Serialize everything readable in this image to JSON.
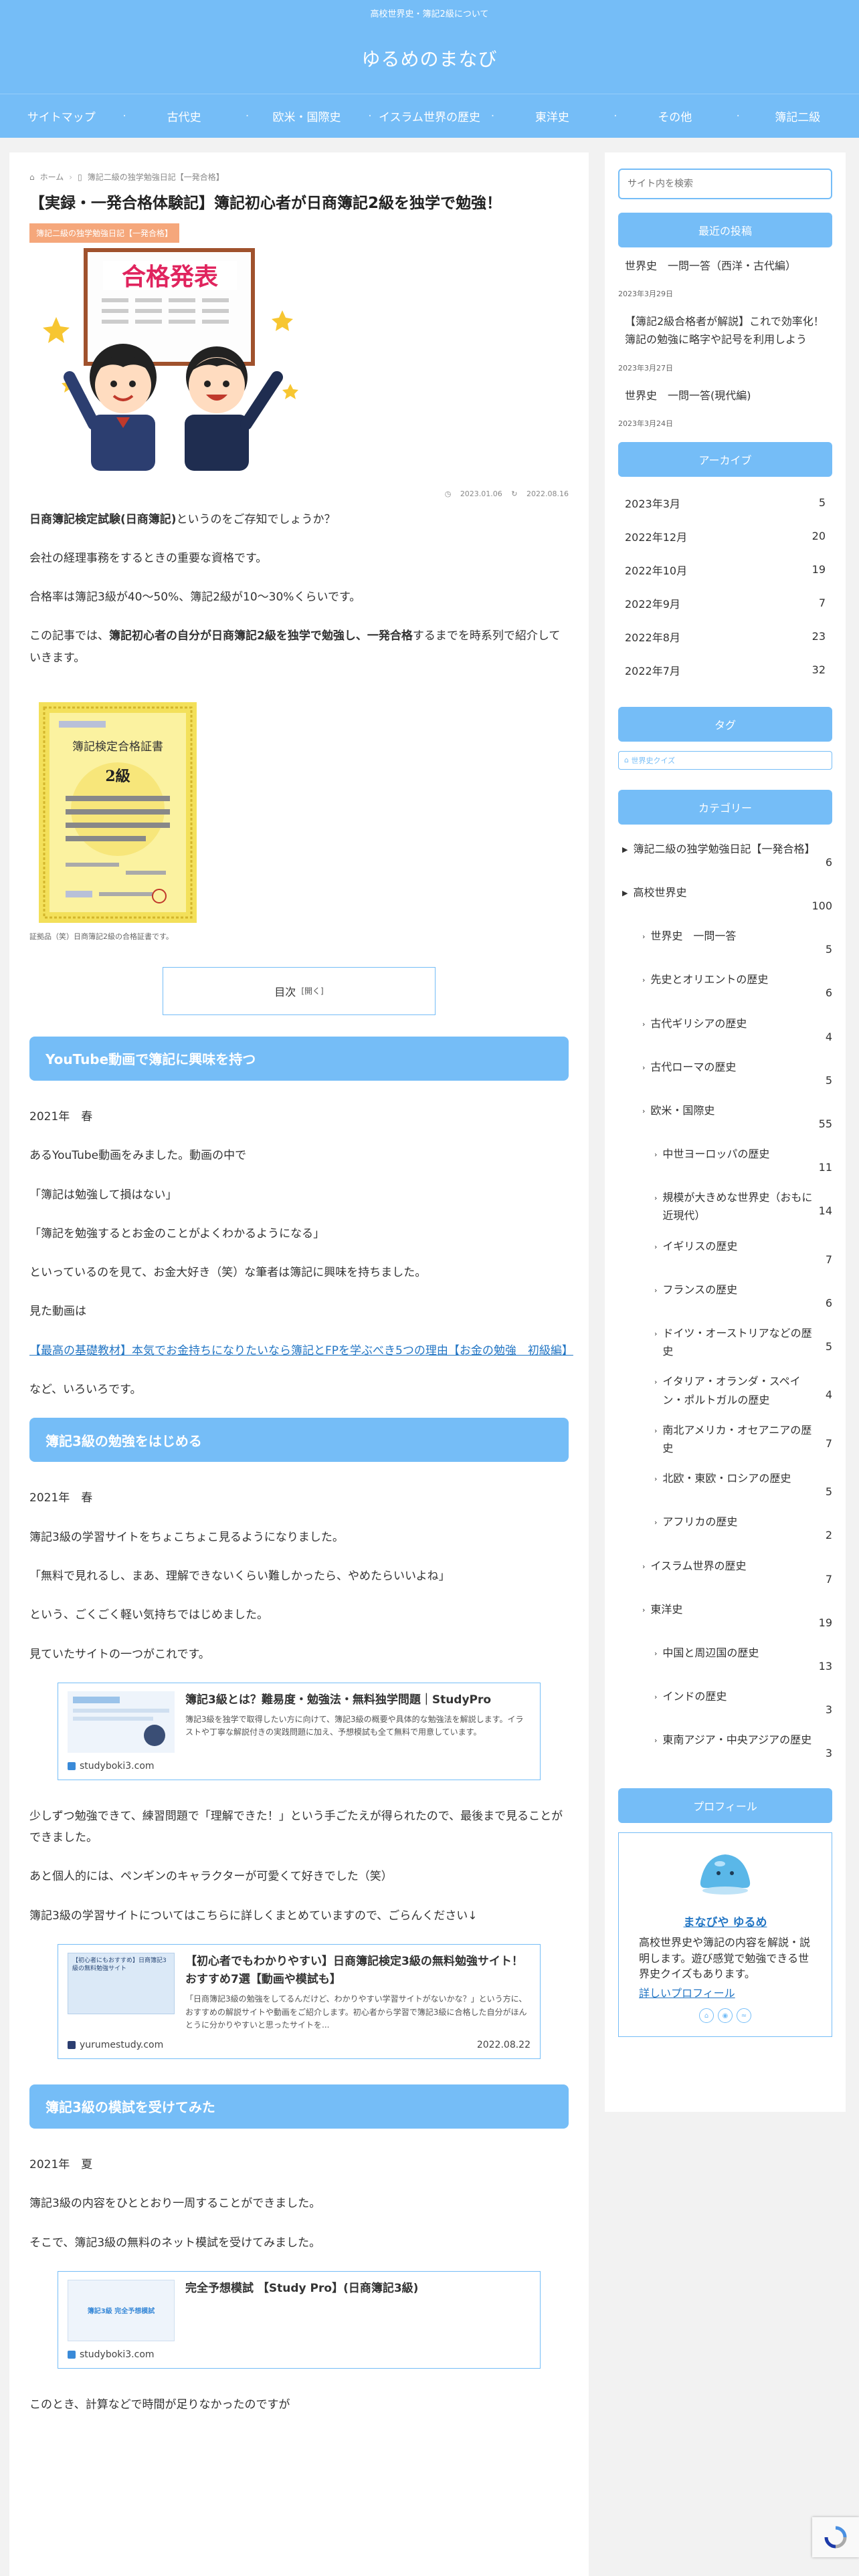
{
  "header": {
    "tagline": "高校世界史・簿記2級について",
    "site_title": "ゆるめのまなび"
  },
  "nav": [
    "サイトマップ",
    "古代史",
    "欧米・国際史",
    "イスラム世界の歴史",
    "東洋史",
    "その他",
    "簿記二級"
  ],
  "breadcrumb": {
    "home": "ホーム",
    "category": "簿記二級の独学勉強日記【一発合格】"
  },
  "article": {
    "title": "【実録・一発合格体験記】簿記初心者が日商簿記2級を独学で勉強！",
    "category_label": "簿記二級の独学勉強日記【一発合格】",
    "eyecatch_sign": "合格発表",
    "published": "2023.01.06",
    "updated": "2022.08.16",
    "intro": {
      "p1_bold": "日商簿記検定試験(日商簿記)",
      "p1_rest": "というのをご存知でしょうか？",
      "p2": "会社の経理事務をするときの重要な資格です。",
      "p3": "合格率は簿記3級が40～50%、簿記2級が10～30%くらいです。",
      "p4_pre": "この記事では、",
      "p4_bold": "簿記初心者の自分が日商簿記2級を独学で勉強し、一発合格",
      "p4_rest": "するまでを時系列で紹介していきます。"
    },
    "certificate": {
      "title": "簿記検定合格証書",
      "grade": "2級",
      "body": "商工会議所2021年度施行検定試験において頭書の級に合格したことを証する",
      "caption": "証拠品（笑）日商簿記2級の合格証書です。"
    },
    "toc": {
      "label": "目次",
      "toggle": "[開く]"
    },
    "sections": [
      {
        "heading": "YouTube動画で簿記に興味を持つ",
        "paras": [
          "2021年　春",
          "あるYouTube動画をみました。動画の中で",
          "「簿記は勉強して損はない」",
          "「簿記を勉強するとお金のことがよくわかるようになる」",
          "といっているのを見て、お金大好き（笑）な筆者は簿記に興味を持ちました。",
          "見た動画は"
        ],
        "link": "【最高の基礎教材】本気でお金持ちになりたいなら簿記とFPを学ぶべき5つの理由【お金の勉強　初級編】",
        "after": "など、いろいろです。"
      },
      {
        "heading": "簿記3級の勉強をはじめる",
        "paras": [
          "2021年　春",
          "簿記3級の学習サイトをちょこちょこ見るようになりました。",
          "「無料で見れるし、まあ、理解できないくらい難しかったら、やめたらいいよね」",
          "という、ごくごく軽い気持ちではじめました。",
          "見ていたサイトの一つがこれです。"
        ],
        "card1": {
          "title": "簿記3級とは？難易度・勉強法・無料独学問題｜StudyPro",
          "desc": "簿記3級を独学で取得したい方に向けて、簿記3級の概要や具体的な勉強法を解説します。イラストや丁寧な解説付きの実践問題に加え、予想模試も全て無料で用意しています。",
          "site": "studyboki3.com"
        },
        "paras2": [
          "少しずつ勉強できて、練習問題で「理解できた！」という手ごたえが得られたので、最後まで見ることができました。",
          "あと個人的には、ペンギンのキャラクターが可愛くて好きでした（笑）",
          "簿記3級の学習サイトについてはこちらに詳しくまとめていますので、ごらんください↓"
        ],
        "card2": {
          "title": "【初心者でもわかりやすい】日商簿記検定3級の無料勉強サイト！おすすめ7選【動画や模試も】",
          "desc": "「日商簿記3級の勉強をしてるんだけど、わかりやすい学習サイトがないかな？」という方に、おすすめの解説サイトや動画をご紹介します。初心者から学習で簿記3級に合格した自分がほんとうに分かりやすいと思ったサイトを...",
          "site": "yurumestudy.com",
          "date": "2022.08.22",
          "thumb_text": "【初心者にもおすすめ】日商簿記3級の無料勉強サイト"
        }
      },
      {
        "heading": "簿記3級の模試を受けてみた",
        "paras": [
          "2021年　夏",
          "簿記3級の内容をひととおり一周することができました。",
          "そこで、簿記3級の無料のネット模試を受けてみました。"
        ],
        "card3": {
          "title": "完全予想模試 【Study Pro】(日商簿記3級)",
          "site": "studyboki3.com",
          "thumb_text": "簿記3級 完全予想模試"
        },
        "after": "このとき、計算などで時間が足りなかったのですが"
      }
    ]
  },
  "sidebar": {
    "search_placeholder": "サイト内を検索",
    "recent_heading": "最近の投稿",
    "recent": [
      {
        "title": "世界史　一問一答（西洋・古代編）",
        "date": "2023年3月29日"
      },
      {
        "title": "【簿記2級合格者が解説】これで効率化！簿記の勉強に略字や記号を利用しよう",
        "date": "2023年3月27日"
      },
      {
        "title": "世界史　一問一答(現代編)",
        "date": "2023年3月24日"
      }
    ],
    "archive_heading": "アーカイブ",
    "archives": [
      {
        "label": "2023年3月",
        "count": "5"
      },
      {
        "label": "2022年12月",
        "count": "20"
      },
      {
        "label": "2022年10月",
        "count": "19"
      },
      {
        "label": "2022年9月",
        "count": "7"
      },
      {
        "label": "2022年8月",
        "count": "23"
      },
      {
        "label": "2022年7月",
        "count": "32"
      }
    ],
    "tag_heading": "タグ",
    "tag_label": "世界史クイズ",
    "category_heading": "カテゴリー",
    "categories": [
      {
        "label": "簿記二級の独学勉強日記【一発合格】",
        "count": "6",
        "level": 0
      },
      {
        "label": "高校世界史",
        "count": "100",
        "level": 0
      },
      {
        "label": "世界史　一問一答",
        "count": "5",
        "level": 1
      },
      {
        "label": "先史とオリエントの歴史",
        "count": "6",
        "level": 1
      },
      {
        "label": "古代ギリシアの歴史",
        "count": "4",
        "level": 1
      },
      {
        "label": "古代ローマの歴史",
        "count": "5",
        "level": 1
      },
      {
        "label": "欧米・国際史",
        "count": "55",
        "level": 1
      },
      {
        "label": "中世ヨーロッパの歴史",
        "count": "11",
        "level": 2
      },
      {
        "label": "規模が大きめな世界史（おもに近現代）",
        "count": "14",
        "level": 2
      },
      {
        "label": "イギリスの歴史",
        "count": "7",
        "level": 2
      },
      {
        "label": "フランスの歴史",
        "count": "6",
        "level": 2
      },
      {
        "label": "ドイツ・オーストリアなどの歴史",
        "count": "5",
        "level": 2
      },
      {
        "label": "イタリア・オランダ・スペイン・ポルトガルの歴史",
        "count": "4",
        "level": 2
      },
      {
        "label": "南北アメリカ・オセアニアの歴史",
        "count": "7",
        "level": 2
      },
      {
        "label": "北欧・東欧・ロシアの歴史",
        "count": "5",
        "level": 2
      },
      {
        "label": "アフリカの歴史",
        "count": "2",
        "level": 2
      },
      {
        "label": "イスラム世界の歴史",
        "count": "7",
        "level": 1
      },
      {
        "label": "東洋史",
        "count": "19",
        "level": 1
      },
      {
        "label": "中国と周辺国の歴史",
        "count": "13",
        "level": 2
      },
      {
        "label": "インドの歴史",
        "count": "3",
        "level": 2
      },
      {
        "label": "東南アジア・中央アジアの歴史",
        "count": "3",
        "level": 2
      }
    ],
    "profile_heading": "プロフィール",
    "profile": {
      "name": "まなびや ゆるめ",
      "desc": "高校世界史や簿記の内容を解説・説明します。遊び感覚で勉強できる世界史クイズもあります。",
      "link": "詳しいプロフィール"
    }
  },
  "colors": {
    "accent": "#75bdf7",
    "label": "#f5a77b",
    "link": "#2376c4"
  }
}
